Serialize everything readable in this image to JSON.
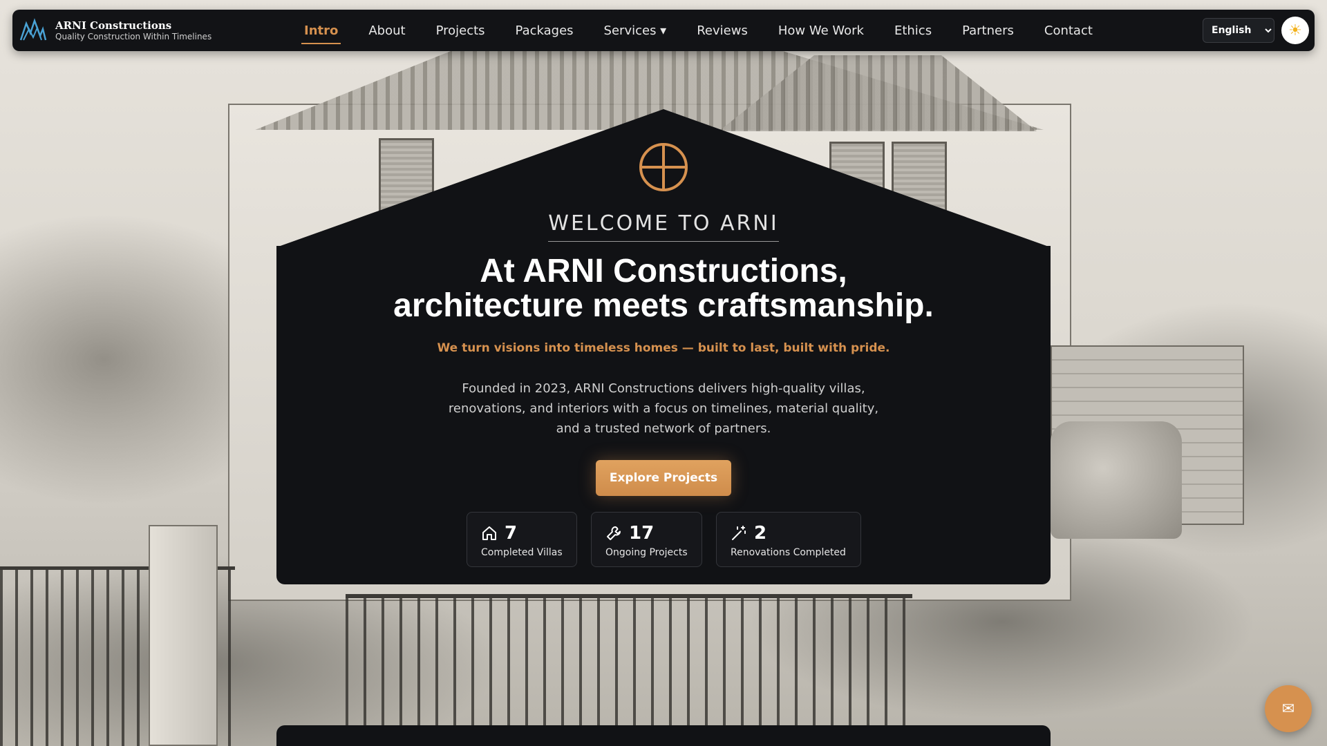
{
  "brand": {
    "name": "ARNI Constructions",
    "tagline": "Quality Construction Within Timelines",
    "logo_icon": "mountain-logo-icon"
  },
  "nav": {
    "items": [
      {
        "label": "Intro",
        "active": true
      },
      {
        "label": "About"
      },
      {
        "label": "Projects"
      },
      {
        "label": "Packages"
      },
      {
        "label": "Services ▾"
      },
      {
        "label": "Reviews"
      },
      {
        "label": "How We Work"
      },
      {
        "label": "Ethics"
      },
      {
        "label": "Partners"
      },
      {
        "label": "Contact"
      }
    ],
    "language": "English",
    "theme_icon": "sun-icon"
  },
  "hero": {
    "kicker": "WELCOME TO ARNI",
    "title_line1": "At ARNI Constructions,",
    "title_line2": "architecture meets craftsmanship.",
    "subtitle": "We turn visions into timeless homes — built to last, built with pride.",
    "description": "Founded in 2023, ARNI Constructions delivers high-quality villas, renovations, and interiors with a focus on timelines, material quality, and a trusted network of partners.",
    "cta_label": "Explore Projects",
    "icon": "crosshair-circle-icon"
  },
  "stats": [
    {
      "value": "7",
      "label": "Completed Villas",
      "icon": "house-icon"
    },
    {
      "value": "17",
      "label": "Ongoing Projects",
      "icon": "wrench-icon"
    },
    {
      "value": "2",
      "label": "Renovations Completed",
      "icon": "magic-wand-icon"
    }
  ],
  "fab": {
    "glyph": "✉",
    "icon": "envelope-icon"
  },
  "colors": {
    "accent": "#d6914f",
    "dark": "#111215",
    "nav_bg": "#121316"
  }
}
